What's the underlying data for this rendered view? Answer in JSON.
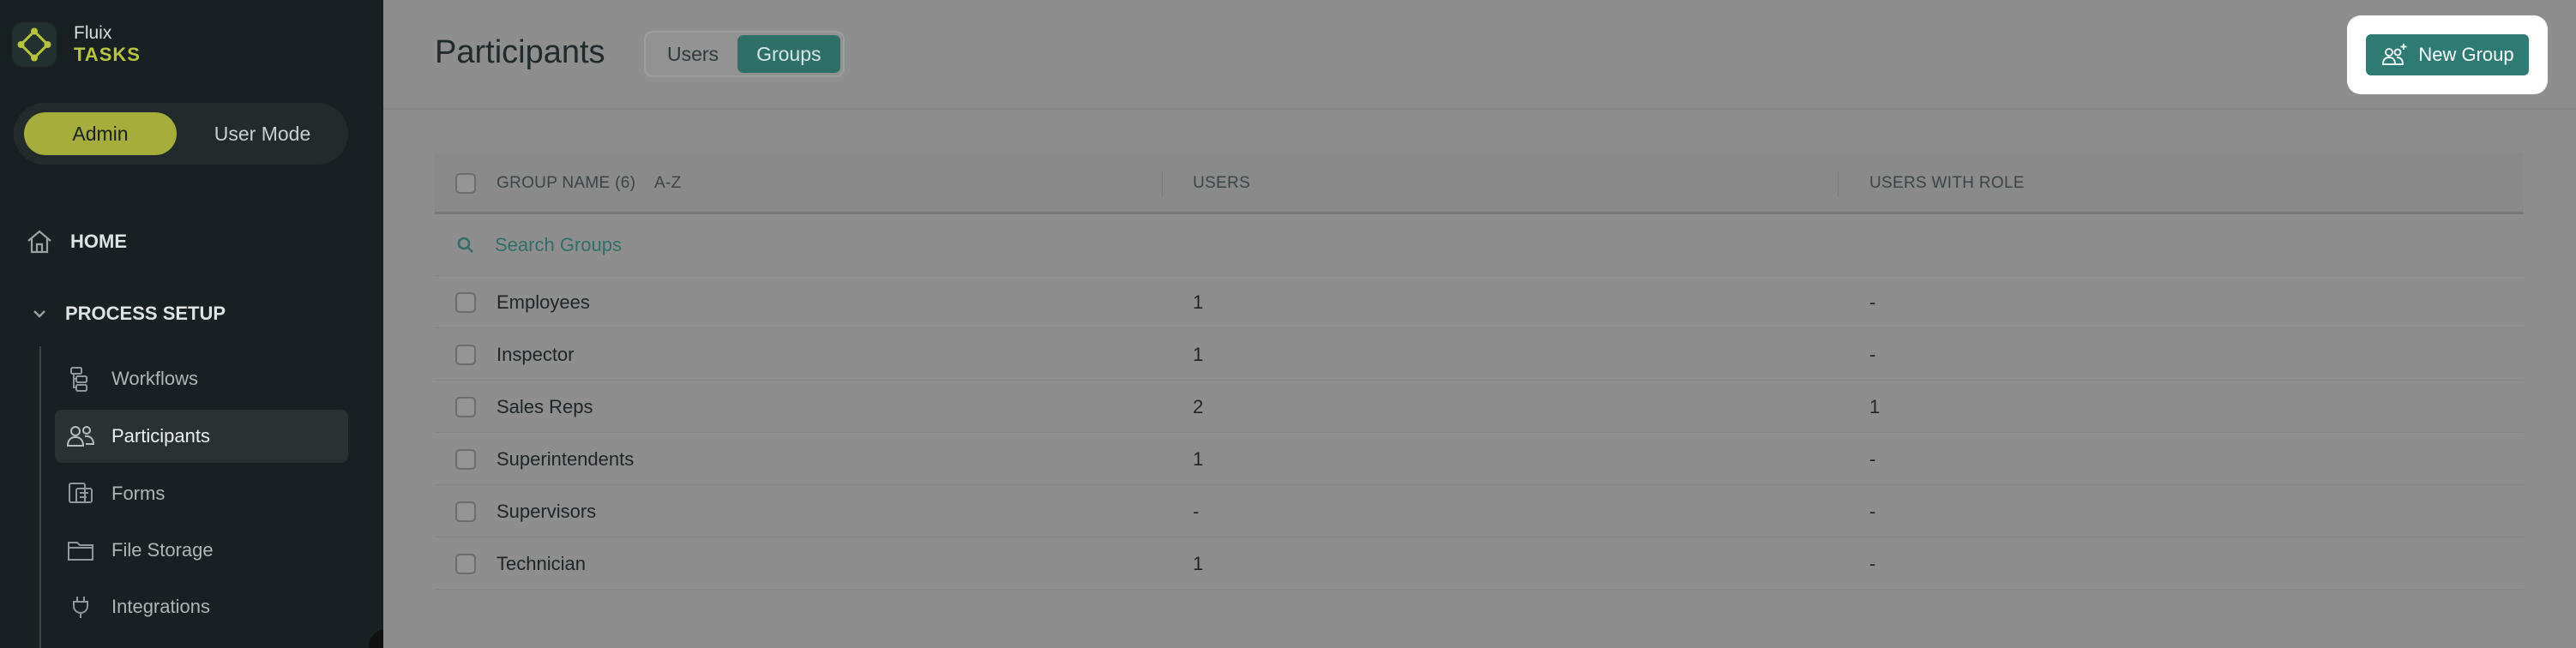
{
  "app": {
    "name": "Fluix",
    "product": "TASKS"
  },
  "mode_toggle": {
    "admin": "Admin",
    "user": "User Mode",
    "selected": "Admin"
  },
  "nav": {
    "home": "HOME",
    "process_setup": "PROCESS SETUP",
    "items": [
      {
        "label": "Workflows",
        "icon": "workflow-icon",
        "active": false
      },
      {
        "label": "Participants",
        "icon": "users-icon",
        "active": true
      },
      {
        "label": "Forms",
        "icon": "forms-icon",
        "active": false
      },
      {
        "label": "File Storage",
        "icon": "folder-icon",
        "active": false
      },
      {
        "label": "Integrations",
        "icon": "plug-icon",
        "active": false
      }
    ]
  },
  "header": {
    "title": "Participants",
    "tabs": [
      {
        "label": "Users",
        "active": false
      },
      {
        "label": "Groups",
        "active": true
      }
    ],
    "new_group_label": "New Group"
  },
  "table": {
    "columns": {
      "name": "GROUP NAME (6)",
      "sort": "A-Z",
      "users": "USERS",
      "role": "USERS WITH ROLE"
    },
    "search_placeholder": "Search Groups",
    "rows": [
      {
        "name": "Employees",
        "users": "1",
        "role": "-"
      },
      {
        "name": "Inspector",
        "users": "1",
        "role": "-"
      },
      {
        "name": "Sales Reps",
        "users": "2",
        "role": "1"
      },
      {
        "name": "Superintendents",
        "users": "1",
        "role": "-"
      },
      {
        "name": "Supervisors",
        "users": "-",
        "role": "-"
      },
      {
        "name": "Technician",
        "users": "1",
        "role": "-"
      }
    ]
  },
  "colors": {
    "accent": "#2f6f6a",
    "sidebar": "#172022",
    "admin_toggle": "#a6ad3a",
    "brand_sub": "#b8c53a"
  }
}
